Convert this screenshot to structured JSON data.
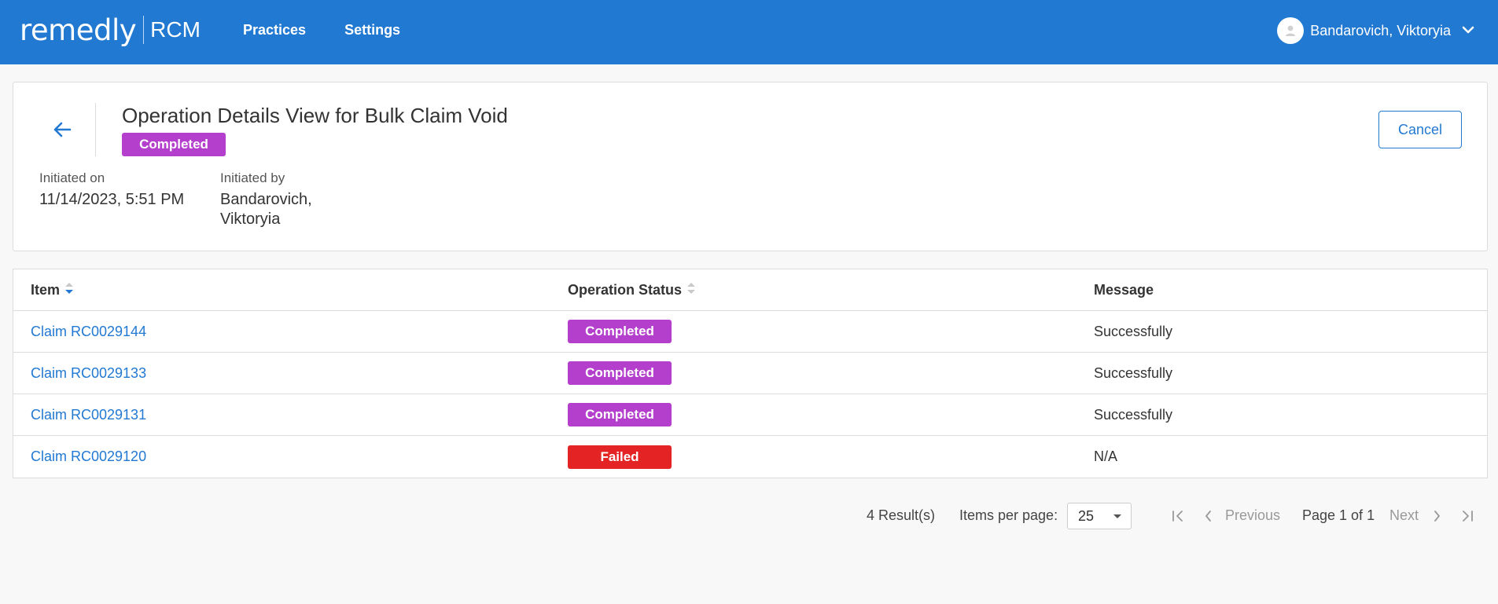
{
  "header": {
    "logo_main": "remedly",
    "logo_sub": "RCM",
    "nav": [
      {
        "label": "Practices"
      },
      {
        "label": "Settings"
      }
    ],
    "user_name": "Bandarovich, Viktoryia"
  },
  "operation": {
    "title": "Operation Details View for Bulk Claim Void",
    "status": "Completed",
    "initiated_on_label": "Initiated on",
    "initiated_on_value": "11/14/2023, 5:51 PM",
    "initiated_by_label": "Initiated by",
    "initiated_by_line1": "Bandarovich,",
    "initiated_by_line2": "Viktoryia",
    "cancel_label": "Cancel"
  },
  "table": {
    "columns": [
      "Item",
      "Operation Status",
      "Message"
    ],
    "rows": [
      {
        "item": "Claim RC0029144",
        "status": "Completed",
        "message": "Successfully"
      },
      {
        "item": "Claim RC0029133",
        "status": "Completed",
        "message": "Successfully"
      },
      {
        "item": "Claim RC0029131",
        "status": "Completed",
        "message": "Successfully"
      },
      {
        "item": "Claim RC0029120",
        "status": "Failed",
        "message": "N/A"
      }
    ]
  },
  "pagination": {
    "results": "4 Result(s)",
    "items_per_page_label": "Items per page:",
    "items_per_page_value": "25",
    "previous_label": "Previous",
    "page_info": "Page 1 of 1",
    "next_label": "Next"
  },
  "colors": {
    "brand": "#2279d2",
    "completed": "#b33fcc",
    "failed": "#e42424"
  }
}
